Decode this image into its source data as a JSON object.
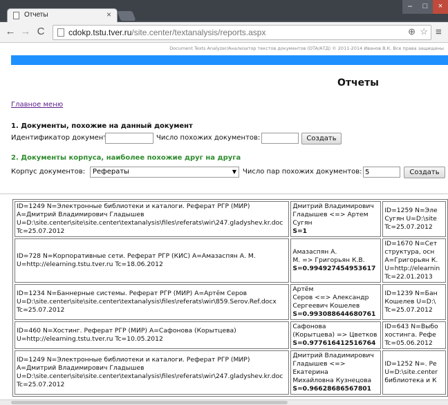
{
  "browser": {
    "tab_title": "Отчеты",
    "tab_close": "×",
    "url_host": "cdokp.tstu.tver.ru",
    "url_path": "/site.center/textanalysis/reports.aspx",
    "window_controls": [
      "–",
      "□",
      "×"
    ]
  },
  "page": {
    "copyright": "Document Texts Analyzer/Анализатор текстов документов (DTA/АТД) © 2011-2014 Иванов В.К. Все права защищены",
    "heading": "Отчеты",
    "main_menu_link": "Главное меню",
    "accent_color": "#1e90ff"
  },
  "section1": {
    "title": "1. Документы, похожие на данный документ",
    "doc_id_label": "Идентификатор документа:",
    "doc_id_value": "",
    "count_label": "Число похожих документов:",
    "count_value": "",
    "create_button": "Создать"
  },
  "section2": {
    "title": "2. Документы корпуса, наиболее похожие друг на друга",
    "corpus_label": "Корпус документов:",
    "corpus_selected": "Рефераты",
    "pairs_label": "Число пар похожих документов:",
    "pairs_value": "5",
    "create_button": "Создать"
  },
  "results": [
    {
      "doc1": [
        "ID=1249 N=Электронные библиотеки и каталоги. Реферат РГР (МИР)",
        "A=Дмитрий Владимирович Гладышев",
        "U=D:\\site.center\\site\\site.center\\textanalysis\\files\\referats\\wir\\247.gladyshev.kr.doc",
        "Tc=25.07.2012"
      ],
      "pair": [
        "Дмитрий Владимирович",
        "Гладышев <=> Артем",
        "Сугян"
      ],
      "score": "S=1",
      "doc2": [
        "ID=1259 N=Эле",
        "Сугян U=D:\\site",
        "Tc=25.07.2012"
      ]
    },
    {
      "doc1": [
        "ID=728 N=Корпоративные сети. Реферат РГР (КИС) A=Амазаспян А. М.",
        "U=http://elearning.tstu.tver.ru Tc=18.06.2012"
      ],
      "pair": [
        "Амазаспян А.",
        "М. => Григорьян К.В."
      ],
      "score": "S=0.994927454953617",
      "doc2": [
        "ID=1670 N=Сет",
        "структура, осн",
        "A=Григорьян К.",
        "U=http://elearnin",
        "Tc=22.01.2013"
      ]
    },
    {
      "doc1": [
        "ID=1234 N=Баннерные системы. Реферат РГР (МИР) A=Артём Серов",
        "U=D:\\site.center\\site\\site.center\\textanalysis\\files\\referats\\wir\\859.Serov.Ref.docx",
        "Tc=25.07.2012"
      ],
      "pair": [
        "Артём",
        "Серов <=> Александр",
        "Сергеевич Кошелев"
      ],
      "score": "S=0.993088644680761",
      "doc2": [
        "ID=1239 N=Бан",
        "Кошелев U=D:\\",
        "Tc=25.07.2012"
      ]
    },
    {
      "doc1": [
        "ID=460 N=Хостинг. Реферат РГР (МИР) A=Сафонова (Корытцева)",
        "U=http://elearning.tstu.tver.ru Tc=10.05.2012"
      ],
      "pair": [
        "Сафонова",
        "(Корытцева) => Цветков"
      ],
      "score": "S=0.977616412516764",
      "doc2": [
        "ID=643 N=Выбо",
        "хостинга. Рефе",
        "Tc=05.06.2012"
      ]
    },
    {
      "doc1": [
        "ID=1249 N=Электронные библиотеки и каталоги. Реферат РГР (МИР)",
        "A=Дмитрий Владимирович Гладышев",
        "U=D:\\site.center\\site\\site.center\\textanalysis\\files\\referats\\wir\\247.gladyshev.kr.doc",
        "Tc=25.07.2012"
      ],
      "pair": [
        "Дмитрий Владимирович",
        "Гладышев <=> Екатерина",
        "Михайловна Кузнецова"
      ],
      "score": "S=0.96628686567801",
      "doc2": [
        "ID=1252 N=. Ре",
        "U=D:\\site.center",
        "библиотека и К"
      ]
    }
  ]
}
